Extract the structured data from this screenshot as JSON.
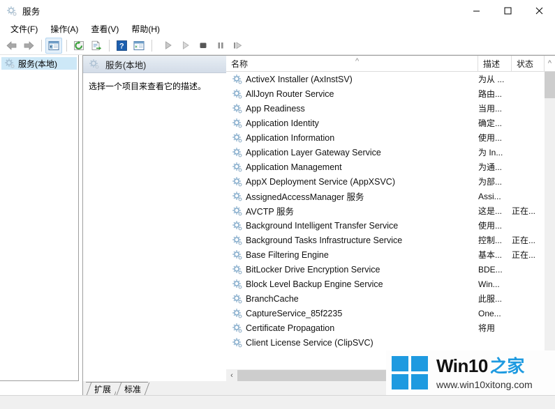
{
  "window": {
    "title": "服务",
    "title_icon": "services-gear-icon",
    "controls": {
      "minimize": "minimize-icon",
      "maximize": "maximize-icon",
      "close": "close-icon"
    }
  },
  "menubar": {
    "items": [
      {
        "label": "文件(F)",
        "name": "menu-file"
      },
      {
        "label": "操作(A)",
        "name": "menu-action"
      },
      {
        "label": "查看(V)",
        "name": "menu-view"
      },
      {
        "label": "帮助(H)",
        "name": "menu-help"
      }
    ]
  },
  "toolbar": {
    "buttons": [
      {
        "name": "back-icon",
        "enabled": false
      },
      {
        "name": "forward-icon",
        "enabled": false
      },
      {
        "name": "show-hide-tree-icon",
        "enabled": true,
        "pressed": true
      },
      {
        "name": "refresh-icon",
        "enabled": true
      },
      {
        "name": "export-list-icon",
        "enabled": true
      },
      {
        "name": "help-icon",
        "enabled": true
      },
      {
        "name": "properties-icon",
        "enabled": true
      },
      {
        "name": "start-service-icon",
        "enabled": false
      },
      {
        "name": "resume-service-icon",
        "enabled": false
      },
      {
        "name": "stop-service-icon",
        "enabled": false
      },
      {
        "name": "pause-service-icon",
        "enabled": false
      },
      {
        "name": "restart-service-icon",
        "enabled": false
      }
    ]
  },
  "tree": {
    "nodes": [
      {
        "label": "服务(本地)",
        "selected": true
      }
    ]
  },
  "detail": {
    "header_title": "服务(本地)",
    "description_placeholder": "选择一个项目来查看它的描述。"
  },
  "list": {
    "columns": [
      {
        "key": "name",
        "label": "名称",
        "sorted": "asc"
      },
      {
        "key": "desc",
        "label": "描述"
      },
      {
        "key": "state",
        "label": "状态"
      }
    ],
    "sort_indicator": "▲",
    "rows": [
      {
        "name": "ActiveX Installer (AxInstSV)",
        "desc": "为从 ...",
        "state": ""
      },
      {
        "name": "AllJoyn Router Service",
        "desc": "路由...",
        "state": ""
      },
      {
        "name": "App Readiness",
        "desc": "当用...",
        "state": ""
      },
      {
        "name": "Application Identity",
        "desc": "确定...",
        "state": ""
      },
      {
        "name": "Application Information",
        "desc": "使用...",
        "state": ""
      },
      {
        "name": "Application Layer Gateway Service",
        "desc": "为 In...",
        "state": ""
      },
      {
        "name": "Application Management",
        "desc": "为通...",
        "state": ""
      },
      {
        "name": "AppX Deployment Service (AppXSVC)",
        "desc": "为部...",
        "state": ""
      },
      {
        "name": "AssignedAccessManager 服务",
        "desc": "Assi...",
        "state": ""
      },
      {
        "name": "AVCTP 服务",
        "desc": "这是...",
        "state": "正在..."
      },
      {
        "name": "Background Intelligent Transfer Service",
        "desc": "使用...",
        "state": ""
      },
      {
        "name": "Background Tasks Infrastructure Service",
        "desc": "控制...",
        "state": "正在..."
      },
      {
        "name": "Base Filtering Engine",
        "desc": "基本...",
        "state": "正在..."
      },
      {
        "name": "BitLocker Drive Encryption Service",
        "desc": "BDE...",
        "state": ""
      },
      {
        "name": "Block Level Backup Engine Service",
        "desc": "Win...",
        "state": ""
      },
      {
        "name": "BranchCache",
        "desc": "此服...",
        "state": ""
      },
      {
        "name": "CaptureService_85f2235",
        "desc": "One...",
        "state": ""
      },
      {
        "name": "Certificate Propagation",
        "desc": "将用",
        "state": ""
      },
      {
        "name": "Client License Service (ClipSVC)",
        "desc": "",
        "state": ""
      }
    ]
  },
  "tabs": {
    "items": [
      {
        "label": "扩展",
        "name": "tab-extended",
        "active": false
      },
      {
        "label": "标准",
        "name": "tab-standard",
        "active": true
      }
    ]
  },
  "statusbar": {
    "text": ""
  },
  "watermark": {
    "brand": "Win10",
    "brand_cn": "之家",
    "url": "www.win10xitong.com",
    "logo_color": "#1e9ae0"
  },
  "colors": {
    "accent": "#1e9ae0",
    "selection": "#cde8f7",
    "header_gradient_top": "#e9eef4",
    "header_gradient_bottom": "#d3dce8",
    "pane_border": "#9e9e9e",
    "scroll_thumb": "#cdcdcd",
    "scroll_track": "#f0f0f0"
  }
}
